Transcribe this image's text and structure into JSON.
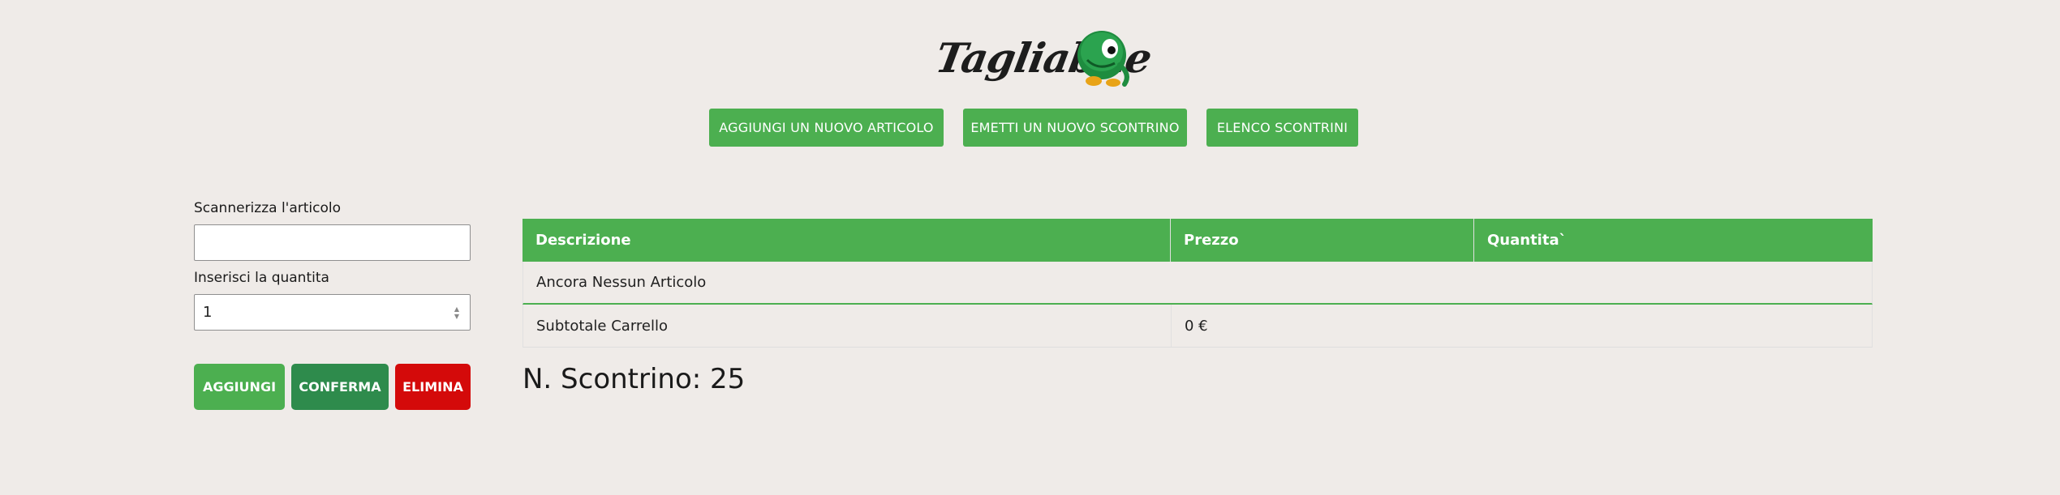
{
  "logo": {
    "brand": "Tagliabue"
  },
  "nav": {
    "add_item": "AGGIUNGI UN NUOVO ARTICOLO",
    "new_receipt": "EMETTI UN NUOVO SCONTRINO",
    "receipt_list": "ELENCO SCONTRINI"
  },
  "form": {
    "scan_label": "Scannerizza l'articolo",
    "scan_value": "",
    "qty_label": "Inserisci la quantita",
    "qty_value": "1"
  },
  "actions": {
    "add": "AGGIUNGI",
    "confirm": "CONFERMA",
    "delete": "ELIMINA"
  },
  "table": {
    "headers": [
      "Descrizione",
      "Prezzo",
      "Quantita`"
    ],
    "empty_message": "Ancora Nessun Articolo",
    "subtotal_label": "Subtotale Carrello",
    "subtotal_value": "0 €"
  },
  "receipt_number": "N. Scontrino: 25",
  "colors": {
    "primary": "#4caf50",
    "confirm": "#2e8b4c",
    "danger": "#d40a0a",
    "background": "#efebe8"
  }
}
